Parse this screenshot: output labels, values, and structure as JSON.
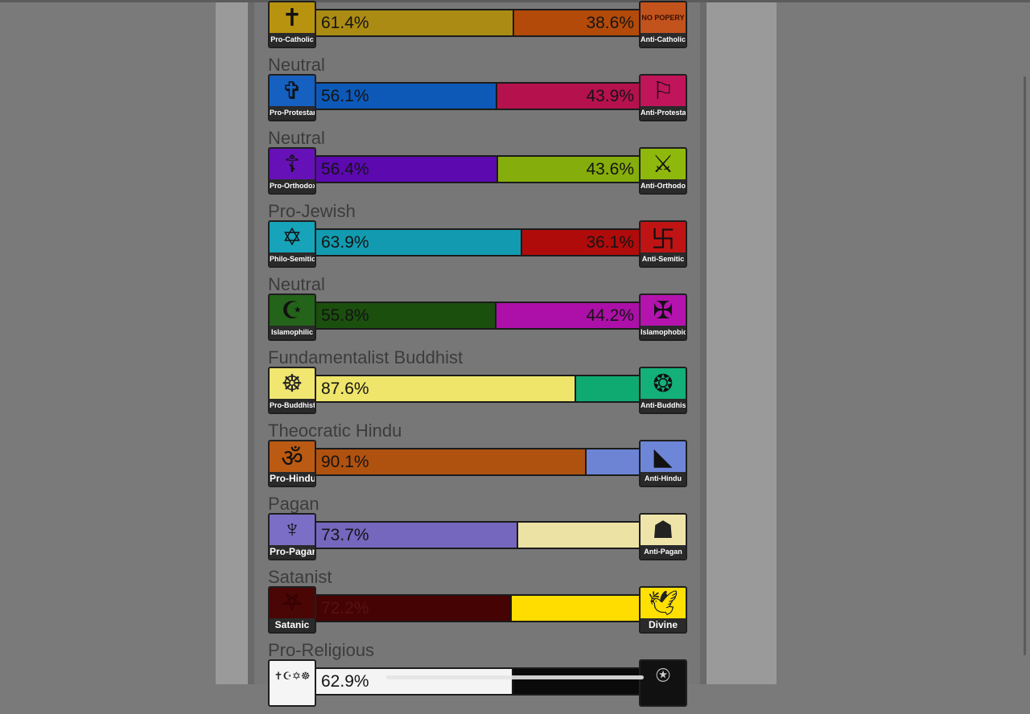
{
  "colors": {
    "page_bg": "#7a7a7a",
    "frame_bg": "#9a9a9a",
    "panel_bg": "#777777"
  },
  "rows": [
    {
      "id": "catholic",
      "label": "",
      "left_pct": "61.4%",
      "right_pct": "38.6%",
      "left_frac": 0.614,
      "left_color": "#ab8b13",
      "right_color": "#b34a0a",
      "left_icon": {
        "name": "crucifix-icon",
        "caption": "Pro-Catholic",
        "bg": "#b8930f",
        "glyph": "✝"
      },
      "right_icon": {
        "name": "no-popery-icon",
        "caption": "Anti-Catholic",
        "bg": "#c2531d",
        "glyph": "NO POPERY"
      }
    },
    {
      "id": "protestant",
      "label": "Neutral",
      "left_pct": "56.1%",
      "right_pct": "43.9%",
      "left_frac": 0.561,
      "left_color": "#0d59b8",
      "right_color": "#b5114d",
      "left_icon": {
        "name": "luther-rose-icon",
        "caption": "Pro-Protestant",
        "bg": "#1560c0",
        "glyph": "✞"
      },
      "right_icon": {
        "name": "anti-protestant-icon",
        "caption": "Anti-Protestant",
        "bg": "#c0155a",
        "glyph": "⚐"
      }
    },
    {
      "id": "orthodox",
      "label": "Neutral",
      "left_pct": "56.4%",
      "right_pct": "43.6%",
      "left_frac": 0.564,
      "left_color": "#5c09b0",
      "right_color": "#85ad0b",
      "left_icon": {
        "name": "orthodox-cross-icon",
        "caption": "Pro-Orthodox",
        "bg": "#6611b8",
        "glyph": "☦"
      },
      "right_icon": {
        "name": "anti-orthodox-icon",
        "caption": "Anti-Orthodox",
        "bg": "#8fb80c",
        "glyph": "⚔"
      }
    },
    {
      "id": "jewish",
      "label": "Pro-Jewish",
      "left_pct": "63.9%",
      "right_pct": "36.1%",
      "left_frac": 0.639,
      "left_color": "#129bb0",
      "right_color": "#b00b0b",
      "left_icon": {
        "name": "star-of-david-icon",
        "caption": "Philo-Semitic",
        "bg": "#17a4ba",
        "glyph": "✡"
      },
      "right_icon": {
        "name": "swastika-icon",
        "caption": "Anti-Semitic",
        "bg": "#c01414",
        "glyph": "卐"
      }
    },
    {
      "id": "islam",
      "label": "Neutral",
      "left_pct": "55.8%",
      "right_pct": "44.2%",
      "left_frac": 0.558,
      "left_color": "#1b4f0d",
      "right_color": "#ad10a8",
      "left_icon": {
        "name": "crescent-star-icon",
        "caption": "Islamophilic",
        "bg": "#24631a",
        "glyph": "☪"
      },
      "right_icon": {
        "name": "crusader-shield-icon",
        "caption": "Islamophobic",
        "bg": "#b414ad",
        "glyph": "✠"
      }
    },
    {
      "id": "buddhist",
      "label": "Fundamentalist Buddhist",
      "left_pct": "87.6%",
      "right_pct": "",
      "left_frac": 0.805,
      "left_color": "#eee56a",
      "right_color": "#0eaa72",
      "left_icon": {
        "name": "buddha-icon",
        "caption": "Pro-Buddhist",
        "bg": "#f0e670",
        "glyph": "☸"
      },
      "right_icon": {
        "name": "anti-buddhist-icon",
        "caption": "Anti-Buddhist",
        "bg": "#13b07a",
        "glyph": "❂"
      }
    },
    {
      "id": "hindu",
      "label": "Theocratic Hindu",
      "left_pct": "90.1%",
      "right_pct": "",
      "left_frac": 0.838,
      "left_color": "#b0520f",
      "right_color": "#6d84d4",
      "left_icon": {
        "name": "om-icon",
        "caption": "Pro-Hindu",
        "bg": "#bb5a12",
        "glyph": "ॐ"
      },
      "right_icon": {
        "name": "pakistan-map-icon",
        "caption": "Anti-Hindu",
        "bg": "#6e86d8",
        "glyph": "◣"
      }
    },
    {
      "id": "pagan",
      "label": "Pagan",
      "left_pct": "73.7%",
      "right_pct": "",
      "left_frac": 0.625,
      "left_color": "#7467bd",
      "right_color": "#ece2a4",
      "left_icon": {
        "name": "horned-god-icon",
        "caption": "Pro-Pagan",
        "bg": "#7b6ec6",
        "glyph": "♆"
      },
      "right_icon": {
        "name": "anti-pagan-icon",
        "caption": "Anti-Pagan",
        "bg": "#eee4aa",
        "glyph": "☗"
      }
    },
    {
      "id": "satanic",
      "label": "Satanist",
      "left_pct": "72.2%",
      "right_pct": "",
      "left_frac": 0.605,
      "left_color": "#450303",
      "right_color": "#ffdd00",
      "left_icon": {
        "name": "pentagram-icon",
        "caption": "Satanic",
        "bg": "#4a0505",
        "glyph": "⛧"
      },
      "right_icon": {
        "name": "dove-icon",
        "caption": "Divine",
        "bg": "#ffe000",
        "glyph": "🕊"
      }
    },
    {
      "id": "religious",
      "label": "Pro-Religious",
      "left_pct": "62.9%",
      "right_pct": "",
      "left_frac": 0.61,
      "left_color": "#f4f4f4",
      "right_color": "#0a0a0a",
      "left_icon": {
        "name": "religious-symbols-icon",
        "caption": "",
        "bg": "#f5f5f5",
        "glyph": "✝☪✡☸"
      },
      "right_icon": {
        "name": "atheism-icon",
        "caption": "",
        "bg": "#111111",
        "glyph": "⍟"
      }
    }
  ]
}
